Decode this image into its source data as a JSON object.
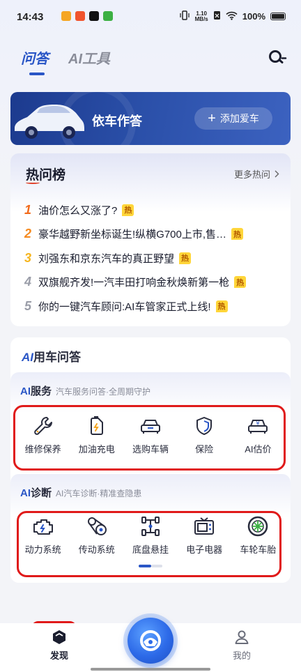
{
  "status": {
    "time": "14:43",
    "net_speed_top": "1.10",
    "net_speed_bottom": "MB/s",
    "battery": "100%"
  },
  "top_tabs": [
    {
      "label": "问答",
      "active": true
    },
    {
      "label": "AI工具",
      "active": false
    }
  ],
  "banner": {
    "title": "依车作答",
    "button_label": "添加爱车"
  },
  "hot": {
    "title": "热问榜",
    "more_label": "更多热问",
    "badge": "热",
    "items": [
      {
        "rank": "1",
        "text": "油价怎么又涨了?"
      },
      {
        "rank": "2",
        "text": "豪华越野新坐标诞生!纵横G700上市,售…"
      },
      {
        "rank": "3",
        "text": "刘强东和京东汽车的真正野望"
      },
      {
        "rank": "4",
        "text": "双旗舰齐发!一汽丰田打响金秋焕新第一枪"
      },
      {
        "rank": "5",
        "text": "你的一键汽车顾问:AI车管家正式上线!"
      }
    ]
  },
  "ai_card": {
    "title_ai": "AI",
    "title_rest": "用车问答",
    "service": {
      "name_ai": "AI",
      "name_rest": "服务",
      "subtitle": "汽车服务问答·全周期守护",
      "items": [
        {
          "label": "维修保养",
          "icon": "wrench-icon"
        },
        {
          "label": "加油充电",
          "icon": "fuel-can-icon"
        },
        {
          "label": "选购车辆",
          "icon": "car-front-icon"
        },
        {
          "label": "保险",
          "icon": "shield-icon"
        },
        {
          "label": "AI估价",
          "icon": "car-price-icon"
        }
      ]
    },
    "diagnosis": {
      "name_ai": "AI",
      "name_rest": "诊断",
      "subtitle": "AI汽车诊断·精准查隐患",
      "items": [
        {
          "label": "动力系统",
          "icon": "engine-icon"
        },
        {
          "label": "传动系统",
          "icon": "transmission-icon"
        },
        {
          "label": "底盘悬挂",
          "icon": "chassis-icon"
        },
        {
          "label": "电子电器",
          "icon": "electronics-icon"
        },
        {
          "label": "车轮车胎",
          "icon": "wheel-icon"
        }
      ]
    }
  },
  "bottom_nav": {
    "discover": "发现",
    "mine": "我的"
  },
  "colors": {
    "accent": "#2a56c6",
    "hot_badge": "#ffd63a",
    "annotation": "#e01a1a"
  }
}
